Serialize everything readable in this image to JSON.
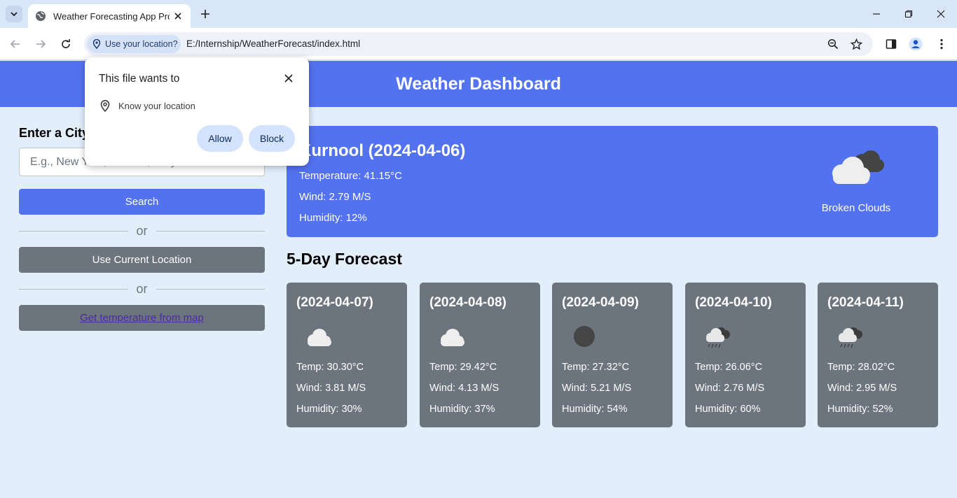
{
  "browser": {
    "tab_title": "Weather Forecasting App Proje",
    "url": "E:/Internship/WeatherForecast/index.html",
    "location_chip": "Use your location?"
  },
  "page": {
    "header_title": "Weather Dashboard",
    "city_label": "Enter a City Name",
    "city_placeholder": "E.g., New York, London, Tokyo",
    "search_label": "Search",
    "or_text": "or",
    "current_location_label": "Use Current Location",
    "map_label": "Get temperature from map",
    "forecast_title": "5-Day Forecast"
  },
  "current": {
    "title": "Kurnool (2024-04-06)",
    "temperature": "Temperature: 41.15°C",
    "wind": "Wind: 2.79 M/S",
    "humidity": "Humidity: 12%",
    "description": "Broken Clouds",
    "icon": "broken-clouds-icon"
  },
  "forecast": [
    {
      "date": "(2024-04-07)",
      "temp": "Temp: 30.30°C",
      "wind": "Wind: 3.81 M/S",
      "humidity": "Humidity: 30%",
      "icon": "cloud-icon"
    },
    {
      "date": "(2024-04-08)",
      "temp": "Temp: 29.42°C",
      "wind": "Wind: 4.13 M/S",
      "humidity": "Humidity: 37%",
      "icon": "cloud-icon"
    },
    {
      "date": "(2024-04-09)",
      "temp": "Temp: 27.32°C",
      "wind": "Wind: 5.21 M/S",
      "humidity": "Humidity: 54%",
      "icon": "overcast-icon"
    },
    {
      "date": "(2024-04-10)",
      "temp": "Temp: 26.06°C",
      "wind": "Wind: 2.76 M/S",
      "humidity": "Humidity: 60%",
      "icon": "rain-cloud-icon"
    },
    {
      "date": "(2024-04-11)",
      "temp": "Temp: 28.02°C",
      "wind": "Wind: 2.95 M/S",
      "humidity": "Humidity: 52%",
      "icon": "rain-cloud-icon"
    }
  ],
  "popup": {
    "title": "This file wants to",
    "permission": "Know your location",
    "allow_label": "Allow",
    "block_label": "Block"
  },
  "colors": {
    "accent": "#5372f0",
    "card_grey": "#6c757d",
    "page_bg": "#e2effb"
  }
}
